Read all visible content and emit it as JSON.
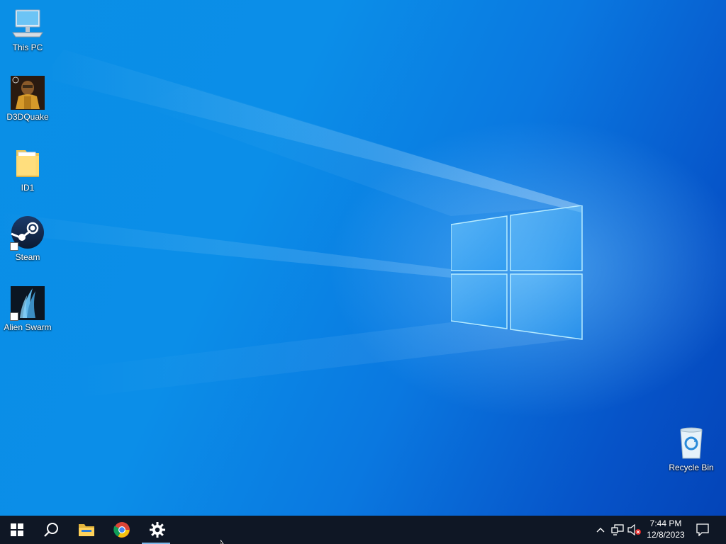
{
  "desktop": {
    "icons": [
      {
        "label": "This PC",
        "icon": "computer-icon"
      },
      {
        "label": "D3DQuake",
        "icon": "quake-icon"
      },
      {
        "label": "ID1",
        "icon": "folder-icon"
      },
      {
        "label": "Steam",
        "icon": "steam-icon"
      },
      {
        "label": "Alien Swarm",
        "icon": "alien-swarm-icon"
      },
      {
        "label": "Recycle Bin",
        "icon": "recycle-bin-icon"
      }
    ]
  },
  "taskbar": {
    "start": "windows-start-icon",
    "search": "search-icon",
    "pinned": [
      "file-explorer-icon",
      "chrome-icon",
      "settings-icon"
    ],
    "active_app": "settings-icon",
    "tray": {
      "chevron": "chevron-up-icon",
      "network": "network-icon",
      "volume": "volume-muted-icon",
      "time": "7:44 PM",
      "date": "12/8/2023",
      "notifications": "action-center-icon"
    }
  },
  "colors": {
    "taskbar": "#0f1725",
    "desktop_accent": "#0a8fe6",
    "active_indicator": "#7cb8e8"
  }
}
